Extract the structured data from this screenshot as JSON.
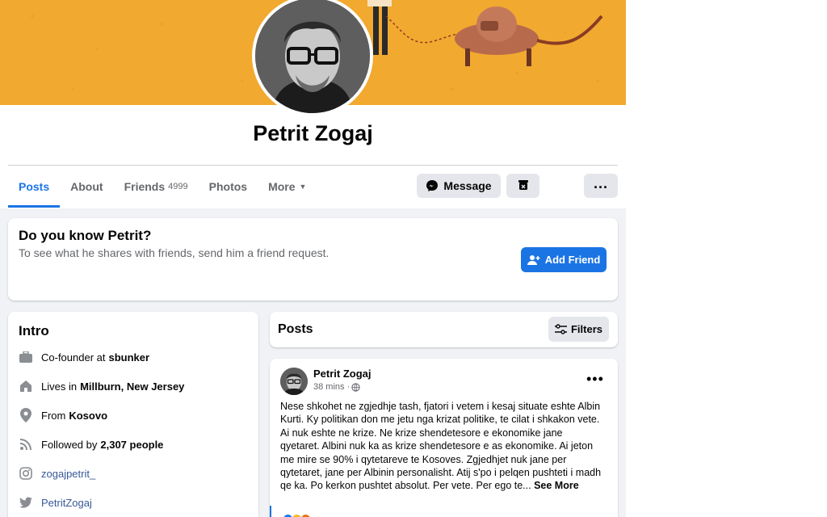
{
  "profile": {
    "name": "Petrit Zogaj"
  },
  "tabs": [
    {
      "label": "Posts"
    },
    {
      "label": "About"
    },
    {
      "label": "Friends",
      "count": "4999"
    },
    {
      "label": "Photos"
    },
    {
      "label": "More"
    }
  ],
  "actions": {
    "message_label": "Message"
  },
  "know_card": {
    "title": "Do you know Petrit?",
    "subtitle": "To see what he shares with friends, send him a friend request.",
    "add_friend_label": "Add Friend"
  },
  "intro": {
    "title": "Intro",
    "work_prefix": "Co-founder at",
    "work_place": "sbunker",
    "lives_prefix": "Lives in",
    "lives_place": "Millburn, New Jersey",
    "from_prefix": "From",
    "from_place": "Kosovo",
    "followed_prefix": "Followed by",
    "followed_count": "2,307 people",
    "instagram": "zogajpetrit_",
    "twitter": "PetritZogaj"
  },
  "posts_section": {
    "title": "Posts",
    "filters_label": "Filters"
  },
  "post": {
    "author": "Petrit Zogaj",
    "time": "38 mins ·",
    "text": "Nese shkohet ne zgjedhje tash, fjatori i vetem i kesaj situate eshte Albin Kurti. Ky politikan don me jetu nga krizat politike, te cilat i shkakon vete. Ai nuk eshte ne krize. Ne krize shendetesore e ekonomike jane qyetaret. Albini nuk ka as krize shendetesore e as ekonomike. Ai jeton me mire se 90% i qytetareve te Kosoves. Zgjedhjet nuk jane per qytetaret, jane per Albinin personalisht. Atij s'po i pelqen pushteti i madh qe ka. Po kerkon pushtet absolut. Per vete. Per ego te...",
    "see_more": "See More"
  },
  "colors": {
    "accent": "#1b74e4",
    "cover": "#f2a92f",
    "page_bg": "#f0f2f5"
  }
}
